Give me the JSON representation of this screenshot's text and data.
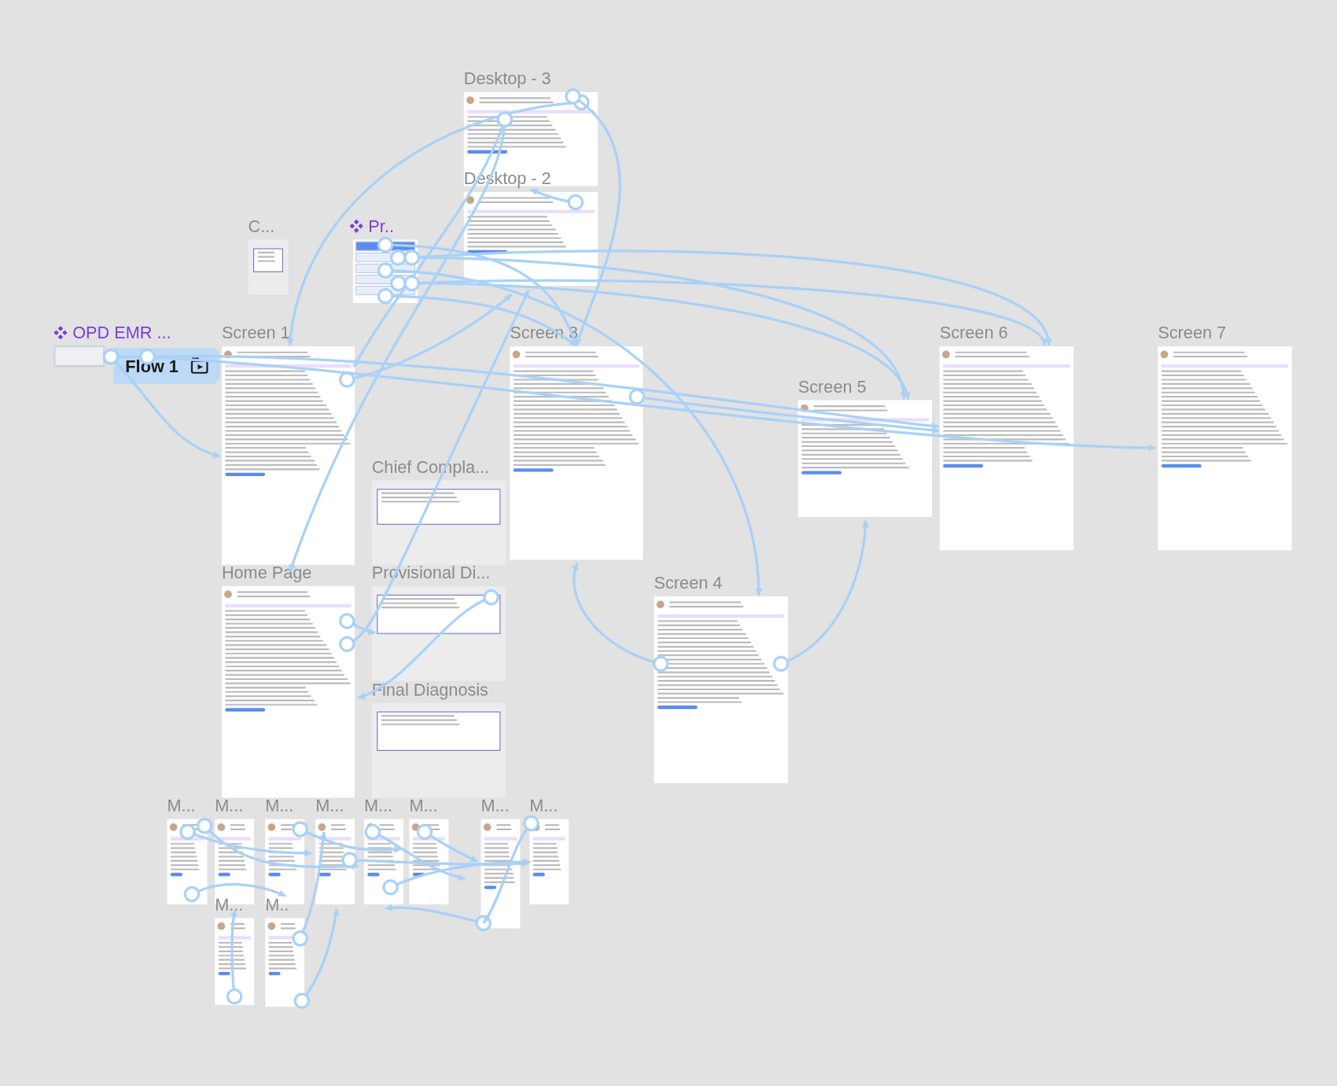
{
  "canvas": {
    "frames": [
      {
        "label": "Desktop - 3",
        "kind": "frame"
      },
      {
        "label": "Desktop - 2",
        "kind": "frame"
      },
      {
        "label": "C...",
        "kind": "frame"
      },
      {
        "label": "Pr..",
        "kind": "component"
      },
      {
        "label": "OPD EMR ...",
        "kind": "component"
      },
      {
        "label": "Screen 1",
        "kind": "frame"
      },
      {
        "label": "Screen 3",
        "kind": "frame"
      },
      {
        "label": "Screen 6",
        "kind": "frame"
      },
      {
        "label": "Screen 7",
        "kind": "frame"
      },
      {
        "label": "Screen 5",
        "kind": "frame"
      },
      {
        "label": "Chief Compla...",
        "kind": "frame"
      },
      {
        "label": "Home Page",
        "kind": "frame"
      },
      {
        "label": "Provisional Di...",
        "kind": "frame"
      },
      {
        "label": "Final Diagnosis",
        "kind": "frame"
      },
      {
        "label": "Screen 4",
        "kind": "frame"
      },
      {
        "label": "M...",
        "kind": "frame"
      },
      {
        "label": "M...",
        "kind": "frame"
      },
      {
        "label": "M...",
        "kind": "frame"
      },
      {
        "label": "M...",
        "kind": "frame"
      },
      {
        "label": "M...",
        "kind": "frame"
      },
      {
        "label": "M...",
        "kind": "frame"
      },
      {
        "label": "M...",
        "kind": "frame"
      },
      {
        "label": "M...",
        "kind": "frame"
      },
      {
        "label": "M...",
        "kind": "frame"
      },
      {
        "label": "M..",
        "kind": "frame"
      }
    ],
    "flow_button": {
      "label": "Flow 1"
    }
  }
}
